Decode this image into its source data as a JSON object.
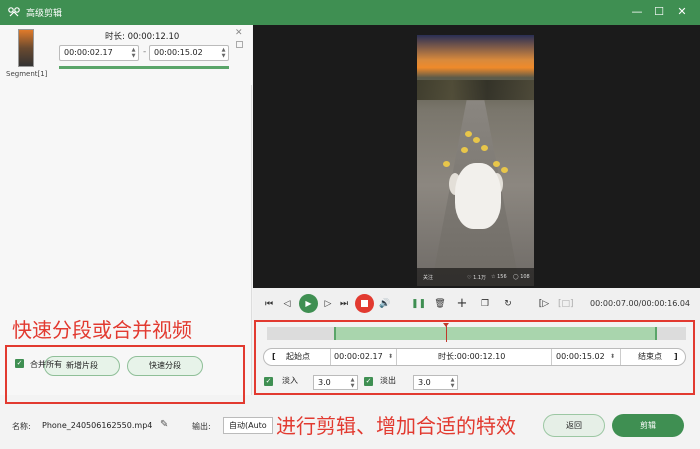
{
  "window": {
    "title": "高级剪辑",
    "minimize": "—",
    "maximize": "☐",
    "close": "✕"
  },
  "segment": {
    "label": "Segment[1]",
    "duration_label": "时长:",
    "duration": "00:00:12.10",
    "start": "00:00:02.17",
    "end": "00:00:15.02",
    "dash": "-"
  },
  "left_tools": {
    "annotation": "快速分段或合并视频",
    "new_segment": "新增片段",
    "quick_split": "快速分段",
    "merge_all": "合并所有",
    "merge_checked": true
  },
  "player": {
    "time": "00:00:07.00/00:00:16.04",
    "overlay_left": "关注",
    "overlay_counts": [
      "1.1万",
      "156",
      "108"
    ]
  },
  "editor": {
    "bracket_open": "[",
    "start_point": "起始点",
    "start": "00:00:02.17",
    "duration_label": "时长:",
    "duration": "00:00:12.10",
    "end": "00:00:15.02",
    "end_point": "结束点",
    "bracket_close": "]",
    "fade_in_label": "淡入",
    "fade_in": "3.0",
    "fade_out_label": "淡出",
    "fade_out": "3.0",
    "annotation": "进行剪辑、增加合适的特效"
  },
  "bottom": {
    "name_label": "名称:",
    "file_name": "Phone_240506162550.mp4",
    "output_label": "输出:",
    "output_value": "自动(Auto",
    "back": "返回",
    "cut": "剪辑"
  },
  "colors": {
    "accent": "#3f8f52",
    "annotation": "#e23a30",
    "stop": "#e23a30"
  }
}
